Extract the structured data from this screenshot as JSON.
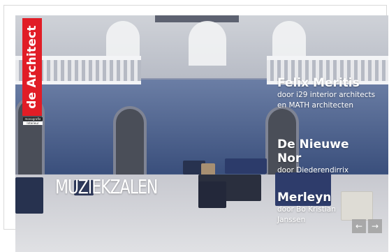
{
  "magazine": {
    "masthead": "de Architect",
    "tags": [
      "monografie",
      "Interieur"
    ],
    "brand_color": "#e11d26"
  },
  "cover": {
    "headline": "MUZIEKZALEN"
  },
  "stories": [
    {
      "title": "Felix Meritis",
      "byline": "door i29 interior architects en MATH architecten"
    },
    {
      "title": "De Nieuwe Nor",
      "byline": "door Diederendirrix"
    },
    {
      "title": "Merleyn",
      "byline": "door Bo Kristian Janssen"
    }
  ],
  "navigation": {
    "prev_icon": "←",
    "next_icon": "→"
  }
}
